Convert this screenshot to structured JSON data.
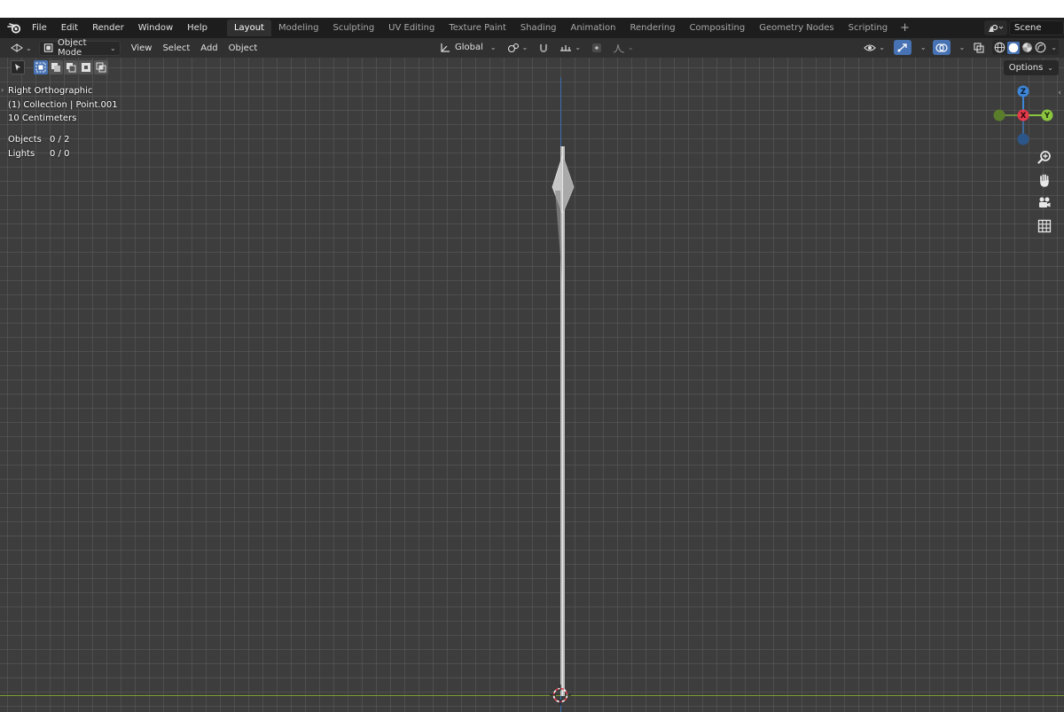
{
  "topbar": {
    "menus": [
      "File",
      "Edit",
      "Render",
      "Window",
      "Help"
    ],
    "workspaces": [
      "Layout",
      "Modeling",
      "Sculpting",
      "UV Editing",
      "Texture Paint",
      "Shading",
      "Animation",
      "Rendering",
      "Compositing",
      "Geometry Nodes",
      "Scripting"
    ],
    "active_workspace": "Layout",
    "add_symbol": "+",
    "scene_name": "Scene"
  },
  "header": {
    "mode": "Object Mode",
    "menus": [
      "View",
      "Select",
      "Add",
      "Object"
    ],
    "orientation": "Global"
  },
  "toolrow": {
    "options_label": "Options"
  },
  "overlay": {
    "view_name": "Right Orthographic",
    "collection": "(1) Collection | Point.001",
    "scale": "10 Centimeters"
  },
  "stats": [
    {
      "label": "Objects",
      "value": "0 / 2"
    },
    {
      "label": "Lights",
      "value": "0 / 0"
    }
  ],
  "gizmo": {
    "z_label": "Z",
    "x_label": "X",
    "y_label": "Y"
  },
  "colors": {
    "accent_blue": "#4772b3",
    "axis_x": "#e2394b",
    "axis_y": "#8bc53f",
    "axis_z": "#3d85d6",
    "grid_bg": "#3d3d3d"
  }
}
